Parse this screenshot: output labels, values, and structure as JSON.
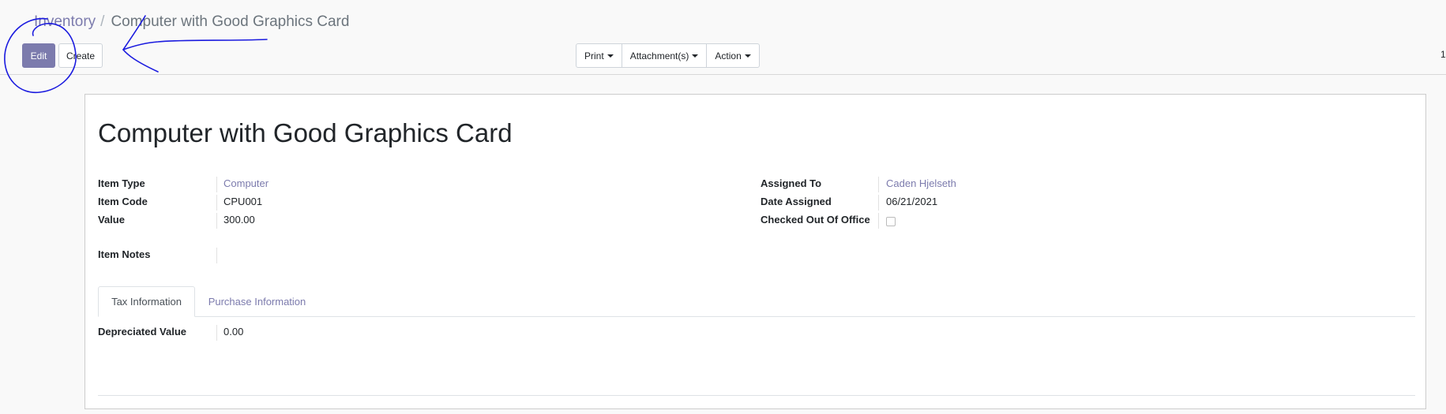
{
  "breadcrumb": {
    "parent": "Inventory",
    "separator": "/",
    "current": "Computer with Good Graphics Card"
  },
  "toolbar": {
    "edit_label": "Edit",
    "create_label": "Create",
    "print_label": "Print",
    "attachments_label": "Attachment(s)",
    "action_label": "Action"
  },
  "pager": {
    "text": "1"
  },
  "record": {
    "title": "Computer with Good Graphics Card",
    "left_fields": [
      {
        "label": "Item Type",
        "value": "Computer"
      },
      {
        "label": "Item Code",
        "value": "CPU001"
      },
      {
        "label": "Value",
        "value": "300.00"
      }
    ],
    "right_fields": [
      {
        "label": "Assigned To",
        "value": "Caden Hjelseth"
      },
      {
        "label": "Date Assigned",
        "value": "06/21/2021"
      },
      {
        "label": "Checked Out Of Office",
        "checked": false
      }
    ],
    "notes": {
      "label": "Item Notes",
      "value": ""
    }
  },
  "tabs": [
    {
      "label": "Tax Information",
      "active": true
    },
    {
      "label": "Purchase Information",
      "active": false
    }
  ],
  "tax_tab": {
    "fields": [
      {
        "label": "Depreciated Value",
        "value": "0.00"
      }
    ]
  },
  "colors": {
    "accent": "#7c7bad",
    "annotation_ink": "#1a1adf"
  },
  "icons": {
    "caret": "caret-down-icon",
    "checkbox": "checkbox-icon"
  }
}
